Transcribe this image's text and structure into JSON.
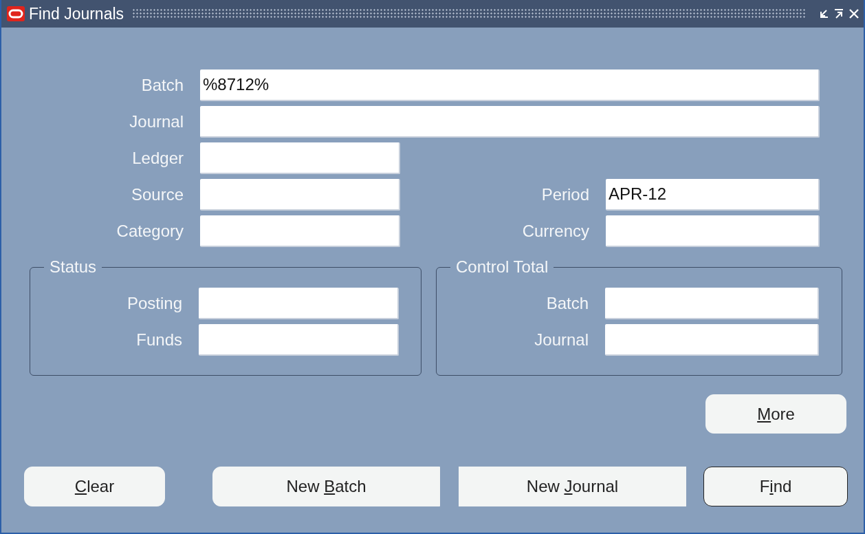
{
  "window": {
    "title": "Find Journals"
  },
  "rows": [
    [
      {
        "label": "Batch",
        "value": "%8712%",
        "kind": "long"
      }
    ],
    [
      {
        "label": "Journal",
        "kind": "long"
      }
    ],
    [
      {
        "label": "Ledger",
        "kind": "short"
      }
    ],
    [
      {
        "label": "Source",
        "kind": "short"
      },
      {
        "label": "Period",
        "value": "APR-12",
        "kind": "short"
      }
    ],
    [
      {
        "label": "Category",
        "kind": "short"
      },
      {
        "label": "Currency",
        "kind": "short"
      }
    ]
  ],
  "groups": [
    {
      "title": "Status",
      "fields": [
        {
          "label": "Posting"
        },
        {
          "label": "Funds"
        }
      ]
    },
    {
      "title": "Control Total",
      "fields": [
        {
          "label": "Batch"
        },
        {
          "label": "Journal"
        }
      ]
    }
  ],
  "more_button": {
    "access_key": "M",
    "label_end": "ore"
  },
  "buttons": [
    {
      "access_key": "C",
      "label_end": "lear",
      "default": false
    },
    {
      "label_start": "New ",
      "access_key": "B",
      "label_end": "atch",
      "default": false
    },
    {
      "label_start": "New ",
      "access_key": "J",
      "label_end": "ournal",
      "default": false
    },
    {
      "label_start": "F",
      "access_key": "i",
      "label_end": "nd",
      "default": true
    }
  ]
}
